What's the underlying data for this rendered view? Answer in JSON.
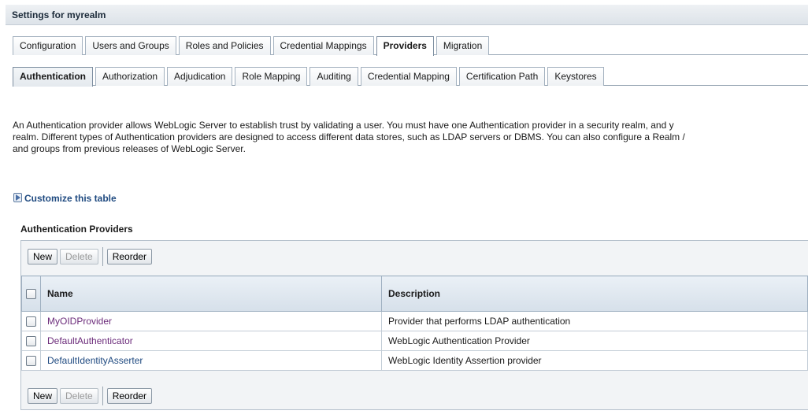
{
  "page_title": "Settings for myrealm",
  "main_tabs": [
    {
      "label": "Configuration"
    },
    {
      "label": "Users and Groups"
    },
    {
      "label": "Roles and Policies"
    },
    {
      "label": "Credential Mappings"
    },
    {
      "label": "Providers",
      "active": true
    },
    {
      "label": "Migration"
    }
  ],
  "sub_tabs": [
    {
      "label": "Authentication",
      "active": true
    },
    {
      "label": "Authorization"
    },
    {
      "label": "Adjudication"
    },
    {
      "label": "Role Mapping"
    },
    {
      "label": "Auditing"
    },
    {
      "label": "Credential Mapping"
    },
    {
      "label": "Certification Path"
    },
    {
      "label": "Keystores"
    }
  ],
  "description": {
    "line1": "An Authentication provider allows WebLogic Server to establish trust by validating a user. You must have one Authentication provider in a security realm, and y",
    "line2": "realm. Different types of Authentication providers are designed to access different data stores, such as LDAP servers or DBMS. You can also configure a Realm /",
    "line3": "and groups from previous releases of WebLogic Server."
  },
  "customize_link": "Customize this table",
  "section_title": "Authentication Providers",
  "buttons": {
    "new": "New",
    "delete": "Delete",
    "reorder": "Reorder"
  },
  "table": {
    "columns": {
      "name": "Name",
      "description": "Description"
    },
    "rows": [
      {
        "name": "MyOIDProvider",
        "description": "Provider that performs LDAP authentication"
      },
      {
        "name": "DefaultAuthenticator",
        "description": "WebLogic Authentication Provider"
      },
      {
        "name": "DefaultIdentityAsserter",
        "description": "WebLogic Identity Assertion provider"
      }
    ]
  },
  "colors": {
    "visited_link": "#6b2b7a",
    "link": "#1f4a80",
    "header_bg": "#d6e0ea"
  }
}
